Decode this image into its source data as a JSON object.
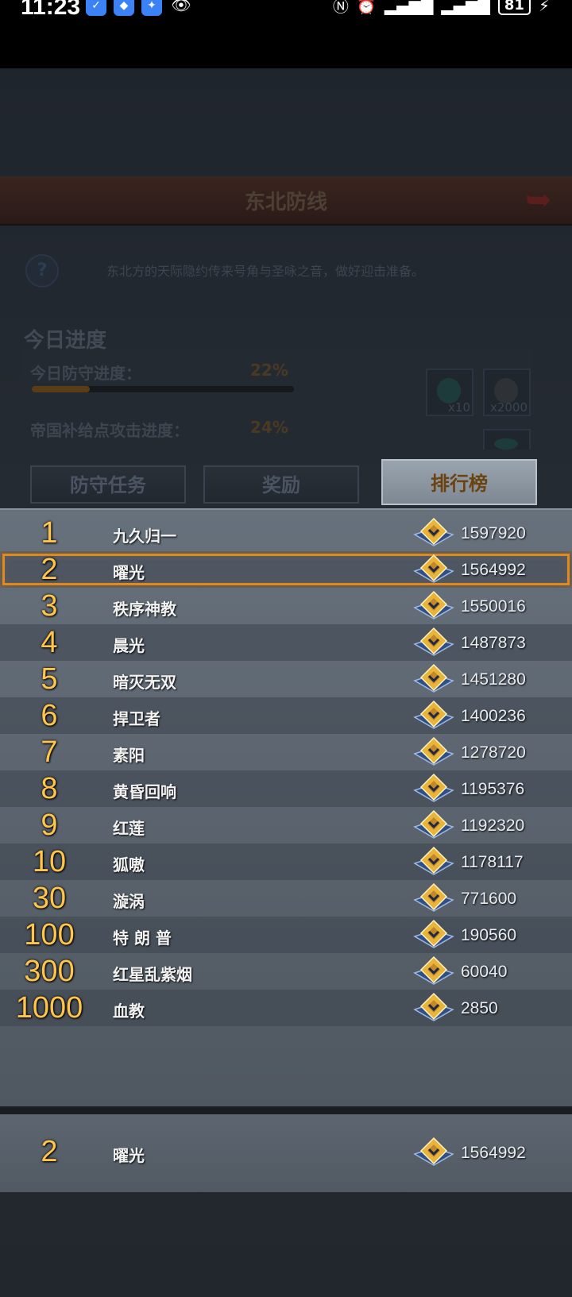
{
  "status_bar": {
    "time": "11:23",
    "battery": "81"
  },
  "header": {
    "title": "东北防线"
  },
  "description": "东北方的天际隐约传来号角与圣咏之音，做好迎击准备。",
  "progress": {
    "section_title": "今日进度",
    "rows": [
      {
        "label": "今日防守进度：",
        "percent": "22%",
        "value": 0.22
      },
      {
        "label": "帝国补给点攻击进度：",
        "percent": "24%",
        "value": 0.24
      }
    ],
    "rewards": [
      {
        "qty": "x10"
      },
      {
        "qty": "x2000"
      }
    ]
  },
  "tabs": [
    {
      "label": "防守任务",
      "active": false
    },
    {
      "label": "奖励",
      "active": false
    },
    {
      "label": "排行榜",
      "active": true
    }
  ],
  "leaderboard": [
    {
      "rank": "1",
      "name": "九久归一",
      "score": "1597920"
    },
    {
      "rank": "2",
      "name": "曜光",
      "score": "1564992",
      "highlight": true
    },
    {
      "rank": "3",
      "name": "秩序神教",
      "score": "1550016"
    },
    {
      "rank": "4",
      "name": "晨光",
      "score": "1487873"
    },
    {
      "rank": "5",
      "name": "暗灭无双",
      "score": "1451280"
    },
    {
      "rank": "6",
      "name": "捍卫者",
      "score": "1400236"
    },
    {
      "rank": "7",
      "name": "素阳",
      "score": "1278720"
    },
    {
      "rank": "8",
      "name": "黄昏回响",
      "score": "1195376"
    },
    {
      "rank": "9",
      "name": "红莲",
      "score": "1192320"
    },
    {
      "rank": "10",
      "name": "狐嗷",
      "score": "1178117"
    },
    {
      "rank": "30",
      "name": "漩涡",
      "score": "771600"
    },
    {
      "rank": "100",
      "name": "特 朗 普",
      "score": "190560"
    },
    {
      "rank": "300",
      "name": "红星乱紫烟",
      "score": "60040"
    },
    {
      "rank": "1000",
      "name": "血教",
      "score": "2850"
    }
  ],
  "my_rank": {
    "rank": "2",
    "name": "曜光",
    "score": "1564992"
  }
}
